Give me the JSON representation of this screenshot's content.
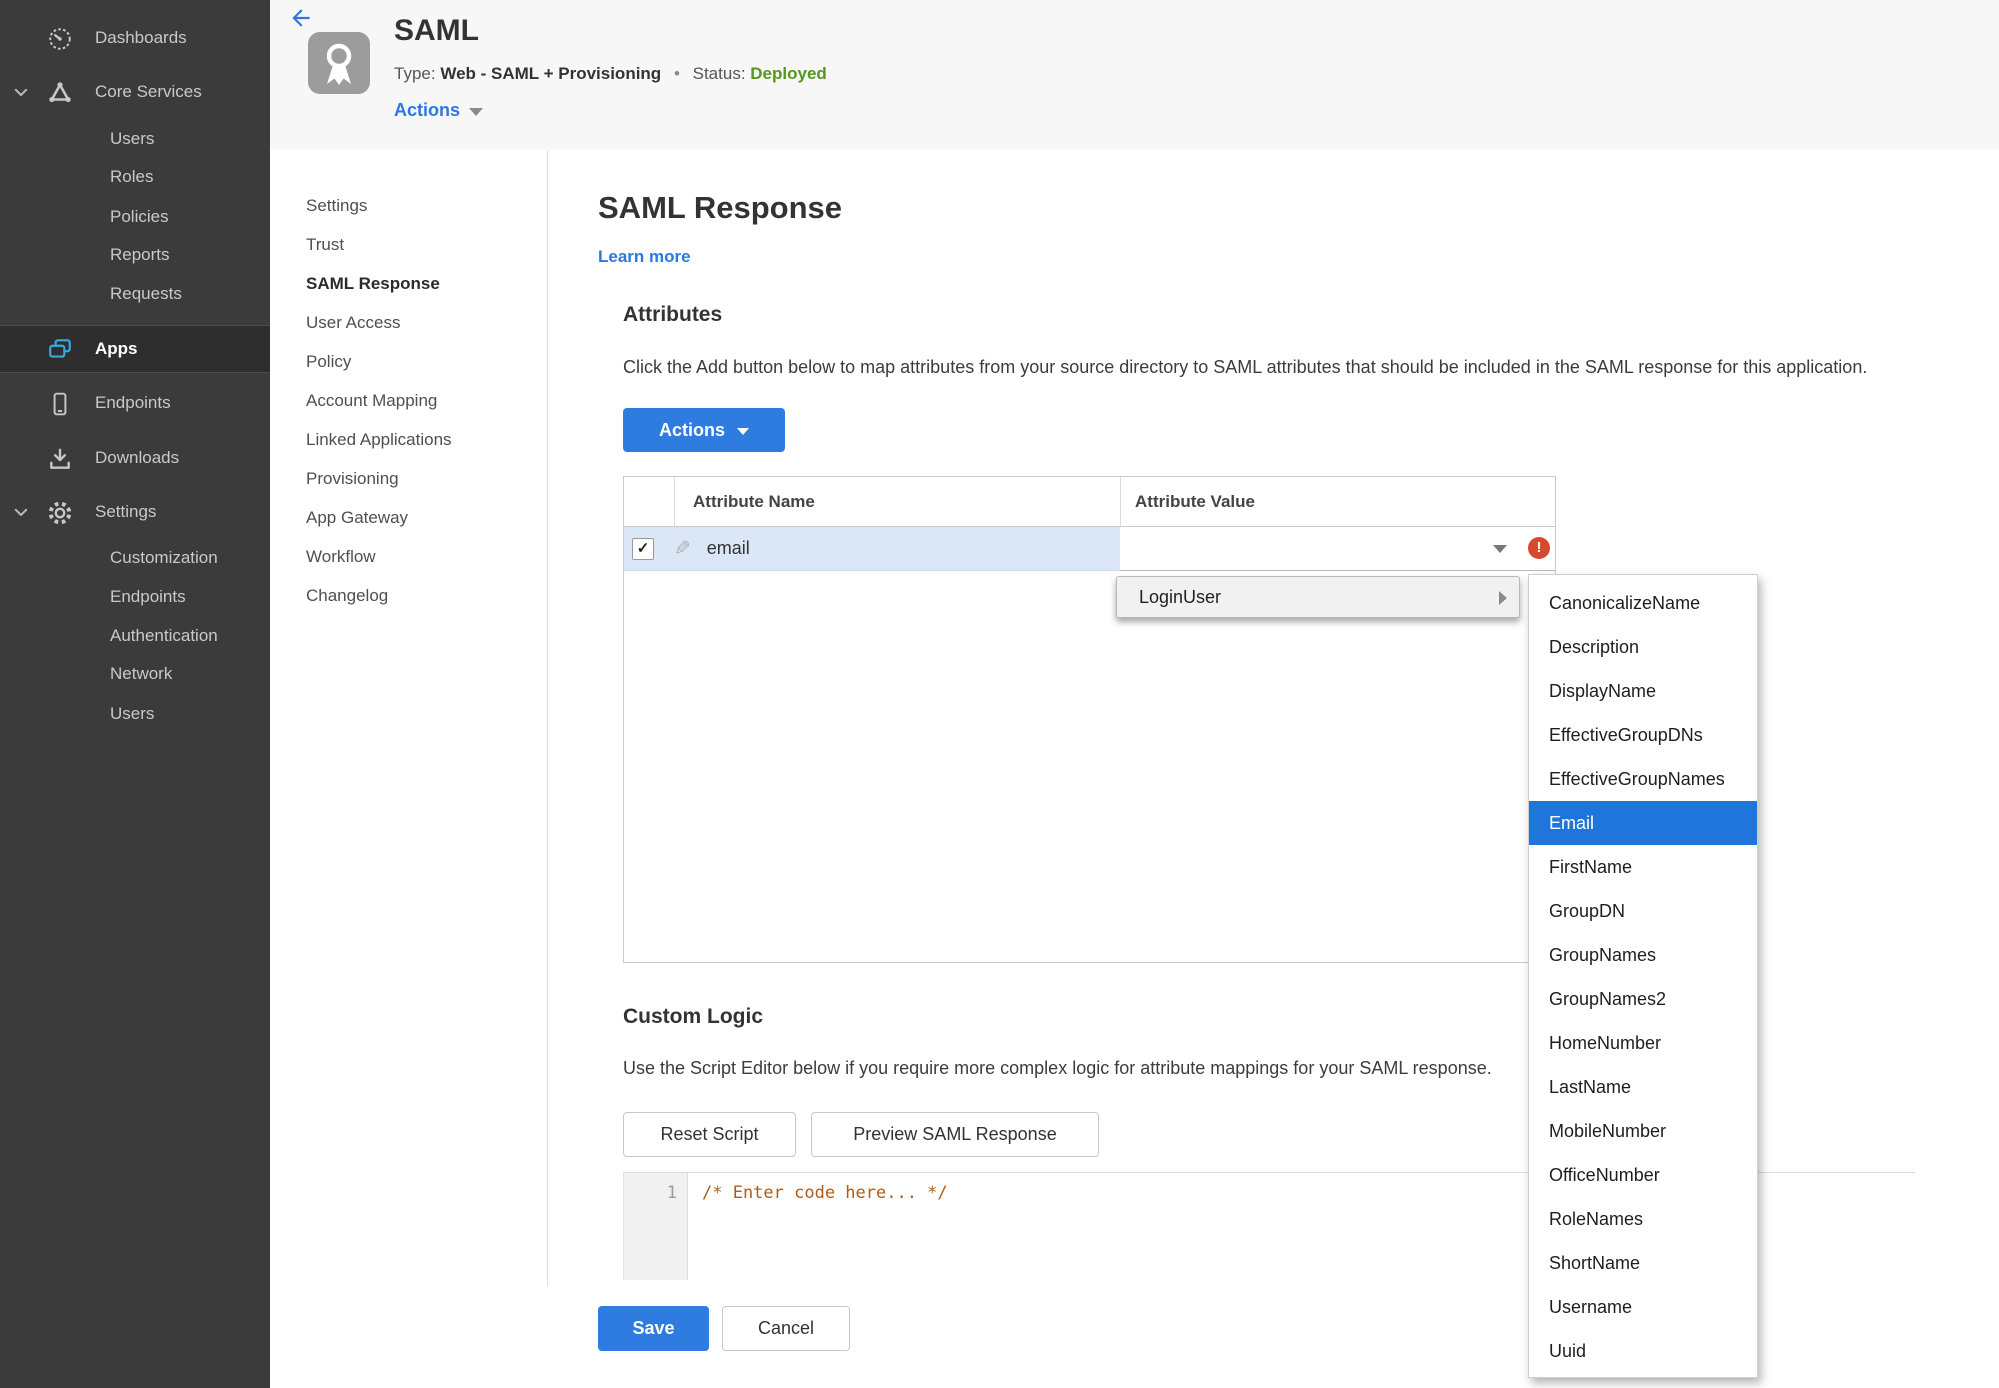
{
  "colors": {
    "accent_blue": "#2e7ce0",
    "link_blue": "#2b78e3",
    "status_green": "#55961c",
    "error_red": "#d6492f",
    "selection_blue": "#1f75dc",
    "row_highlight": "#dbe7f6",
    "sidebar_bg": "#3b3b3b"
  },
  "sidebar": {
    "items": [
      {
        "label": "Dashboards",
        "icon": "gauge-icon"
      },
      {
        "label": "Core Services",
        "icon": "core-services-icon",
        "expanded": true,
        "children": [
          "Users",
          "Roles",
          "Policies",
          "Reports",
          "Requests"
        ]
      },
      {
        "label": "Apps",
        "icon": "apps-icon",
        "selected": true
      },
      {
        "label": "Endpoints",
        "icon": "device-icon"
      },
      {
        "label": "Downloads",
        "icon": "download-icon"
      },
      {
        "label": "Settings",
        "icon": "gear-icon",
        "expanded": true,
        "children": [
          "Customization",
          "Endpoints",
          "Authentication",
          "Network",
          "Users"
        ]
      }
    ]
  },
  "app_header": {
    "title": "SAML",
    "type_label": "Type:",
    "type_value": "Web - SAML + Provisioning",
    "separator": "•",
    "status_label": "Status:",
    "status_value": "Deployed",
    "actions_label": "Actions"
  },
  "nav": {
    "active": "SAML Response",
    "items": [
      "Settings",
      "Trust",
      "SAML Response",
      "User Access",
      "Policy",
      "Account Mapping",
      "Linked Applications",
      "Provisioning",
      "App Gateway",
      "Workflow",
      "Changelog"
    ]
  },
  "main": {
    "title": "SAML Response",
    "learn_more": "Learn more",
    "attributes": {
      "heading": "Attributes",
      "description": "Click the Add button below to map attributes from your source directory to SAML attributes that should be included in the SAML response for this application.",
      "actions_button": "Actions",
      "table": {
        "columns": [
          "Attribute Name",
          "Attribute Value"
        ],
        "rows": [
          {
            "name": "email",
            "value": "",
            "checked": true,
            "error": true
          }
        ]
      }
    },
    "menu": {
      "label": "LoginUser",
      "selected": "Email",
      "submenu": [
        "CanonicalizeName",
        "Description",
        "DisplayName",
        "EffectiveGroupDNs",
        "EffectiveGroupNames",
        "Email",
        "FirstName",
        "GroupDN",
        "GroupNames",
        "GroupNames2",
        "HomeNumber",
        "LastName",
        "MobileNumber",
        "OfficeNumber",
        "RoleNames",
        "ShortName",
        "Username",
        "Uuid"
      ]
    },
    "custom_logic": {
      "heading": "Custom Logic",
      "description": "Use the Script Editor below if you require more complex logic for attribute mappings for your SAML response.",
      "reset_button": "Reset Script",
      "preview_button": "Preview SAML Response",
      "editor": {
        "line_number": "1",
        "code": "/* Enter code here... */"
      }
    },
    "footer": {
      "save": "Save",
      "cancel": "Cancel"
    }
  }
}
